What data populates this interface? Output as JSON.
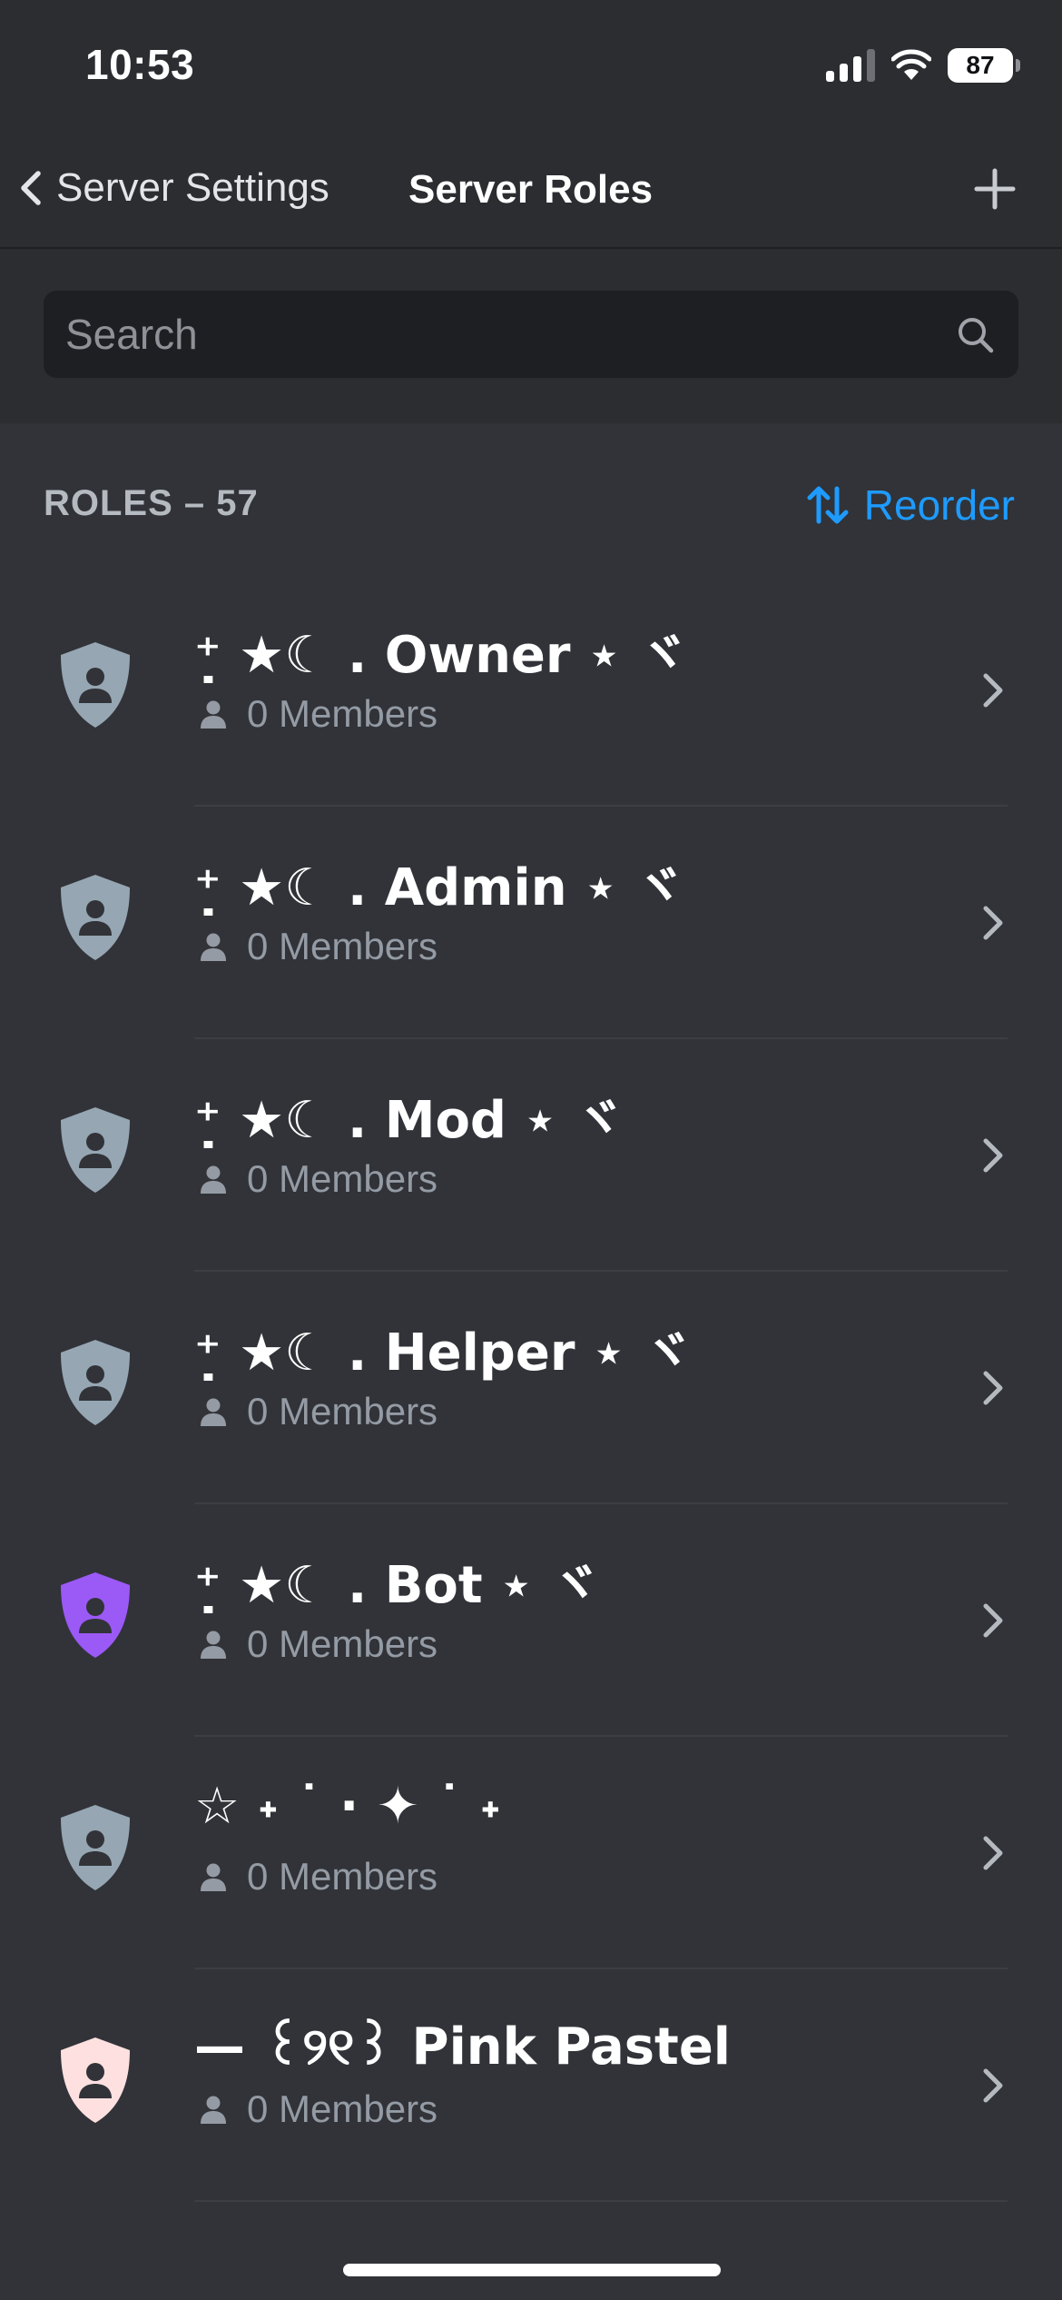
{
  "status_bar": {
    "time": "10:53",
    "battery": "87"
  },
  "header": {
    "back_label": "Server Settings",
    "title": "Server Roles"
  },
  "search": {
    "placeholder": "Search",
    "value": ""
  },
  "roles_section": {
    "count_label": "ROLES – 57",
    "reorder_label": "Reorder"
  },
  "roles": [
    {
      "name": "⁺̣ ★☾ . Owner ⋆ ヾ",
      "members": "0 Members",
      "color": "#96a6b3"
    },
    {
      "name": "⁺̣ ★☾ . Admin ⋆ ヾ",
      "members": "0 Members",
      "color": "#96a6b3"
    },
    {
      "name": "⁺̣ ★☾ . Mod ⋆ ヾ",
      "members": "0 Members",
      "color": "#96a6b3"
    },
    {
      "name": "⁺̣ ★☾ . Helper ⋆ ヾ",
      "members": "0 Members",
      "color": "#96a6b3"
    },
    {
      "name": "⁺̣ ★☾ . Bot ⋆ ヾ",
      "members": "0 Members",
      "color": "#9b59f6"
    },
    {
      "name": "☆   ˖   ˙    · ✦   ˙    ˖",
      "members": "0 Members",
      "color": "#96a6b3"
    },
    {
      "name": "— ꒰୨୧꒱ Pink Pastel",
      "members": "0 Members",
      "color": "#ffe0e0"
    }
  ],
  "icons": {
    "back": "chevron-left-icon",
    "add": "plus-icon",
    "search": "search-icon",
    "reorder": "reorder-arrows-icon",
    "role": "shield-person-icon",
    "member": "person-icon",
    "row": "chevron-right-icon"
  },
  "colors": {
    "background": "#313338",
    "accent": "#1e9bff",
    "muted": "#949ba4"
  }
}
